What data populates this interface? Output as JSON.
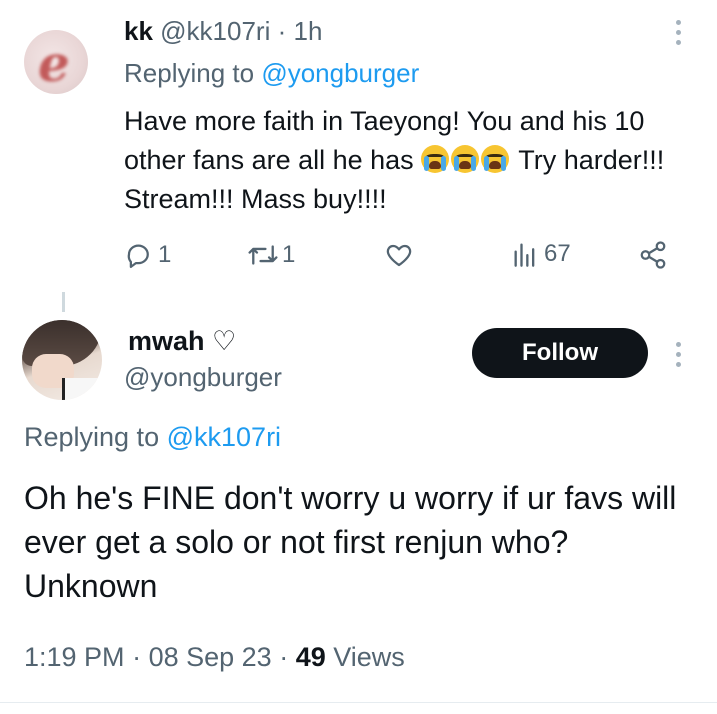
{
  "reply_tweet": {
    "display_name": "kk",
    "handle": "@kk107ri",
    "time": "· 1h",
    "replying_label": "Replying to",
    "replying_handle": "@yongburger",
    "text_before_emoji": "Have more faith in Taeyong! You and his 10 other fans are all he has",
    "emoji": [
      "loudly-crying-face",
      "loudly-crying-face",
      "loudly-crying-face"
    ],
    "text_after_emoji": " Try harder!!! Stream!!! Mass buy!!!!",
    "actions": {
      "reply_count": "1",
      "retweet_count": "1",
      "like_count": "",
      "views_count": "67"
    }
  },
  "main_tweet": {
    "display_name": "mwah ♡",
    "handle": "@yongburger",
    "follow_label": "Follow",
    "replying_label": "Replying to",
    "replying_handle": "@kk107ri",
    "text": "Oh he's FINE don't worry u worry if ur favs will ever get a solo or not first renjun who? Unknown",
    "time": "1:19 PM",
    "date": "08 Sep 23",
    "views_count": "49",
    "views_label": "Views"
  },
  "colors": {
    "text": "#0f1419",
    "muted": "#536471",
    "link": "#1d9bf0",
    "follow_bg": "#0f1419"
  }
}
